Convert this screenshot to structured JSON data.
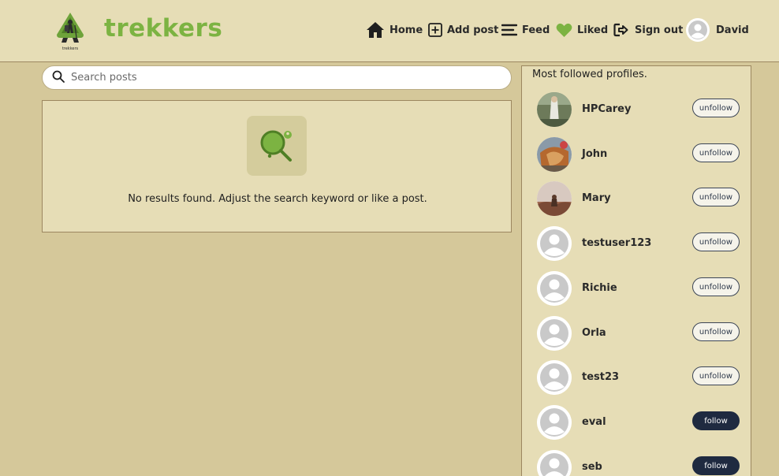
{
  "brand": {
    "name": "trekkers",
    "logo_caption": "trekkers"
  },
  "nav": {
    "home": "Home",
    "add_post": "Add post",
    "feed": "Feed",
    "liked": "Liked",
    "sign_out": "Sign out",
    "user": "David"
  },
  "search": {
    "placeholder": "Search posts",
    "value": ""
  },
  "results": {
    "empty_message": "No results found. Adjust the search keyword or like a post."
  },
  "profiles": {
    "title": "Most followed profiles.",
    "items": [
      {
        "name": "HPCarey",
        "action": "unfollow",
        "avatar": "photo"
      },
      {
        "name": "John",
        "action": "unfollow",
        "avatar": "photo"
      },
      {
        "name": "Mary",
        "action": "unfollow",
        "avatar": "photo"
      },
      {
        "name": "testuser123",
        "action": "unfollow",
        "avatar": "default"
      },
      {
        "name": "Richie",
        "action": "unfollow",
        "avatar": "default"
      },
      {
        "name": "Orla",
        "action": "unfollow",
        "avatar": "default"
      },
      {
        "name": "test23",
        "action": "unfollow",
        "avatar": "default"
      },
      {
        "name": "eval",
        "action": "follow",
        "avatar": "default"
      },
      {
        "name": "seb",
        "action": "follow",
        "avatar": "default"
      }
    ]
  },
  "colors": {
    "accent": "#7cb342",
    "follow_button": "#1f2a40",
    "background": "#d5c89a",
    "panel": "#e6ddb6"
  }
}
